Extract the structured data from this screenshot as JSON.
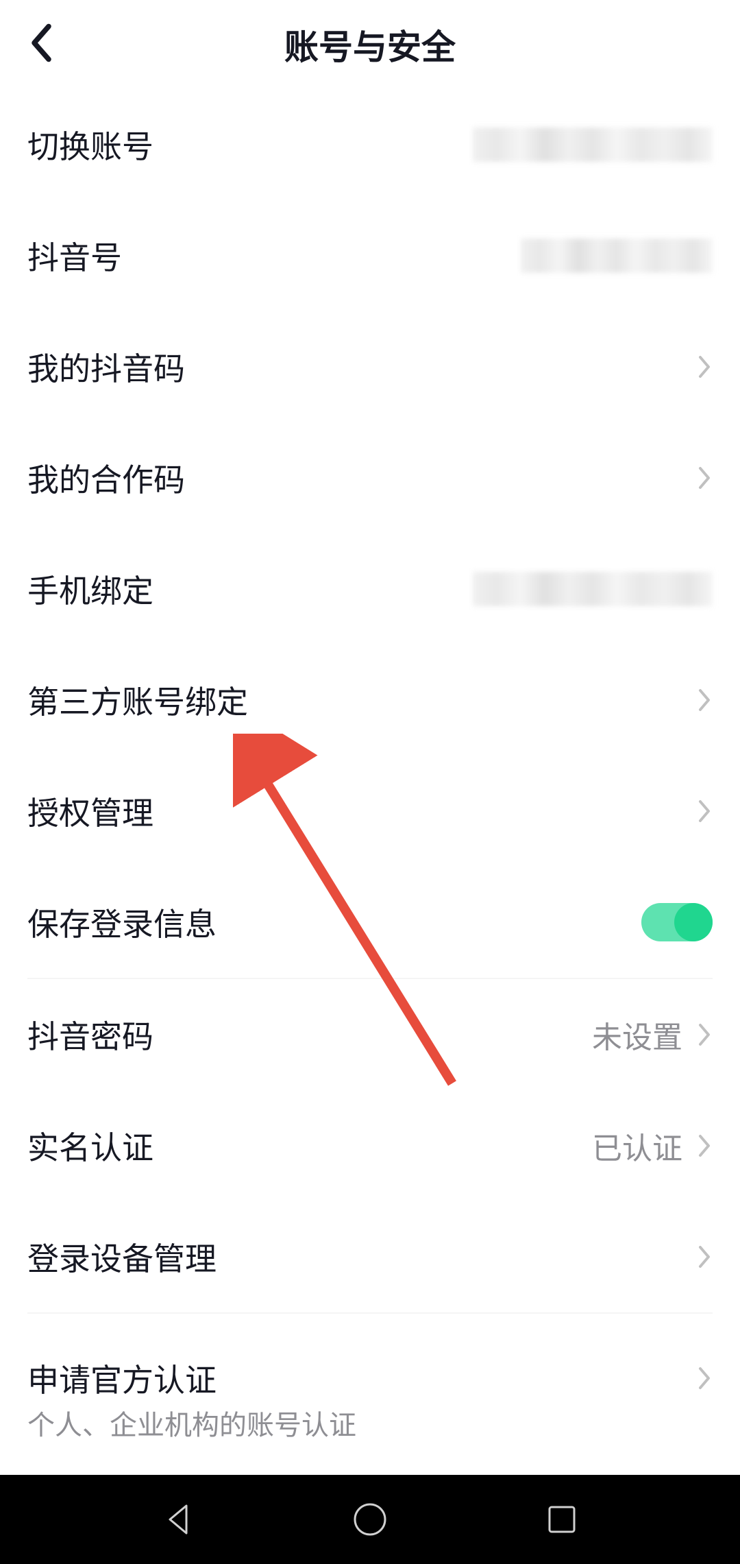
{
  "header": {
    "title": "账号与安全"
  },
  "items": [
    {
      "label": "切换账号",
      "type": "blurred",
      "hasChevron": false
    },
    {
      "label": "抖音号",
      "type": "blurred-small",
      "hasChevron": false
    },
    {
      "label": "我的抖音码",
      "type": "chevron",
      "hasChevron": true
    },
    {
      "label": "我的合作码",
      "type": "chevron",
      "hasChevron": true
    },
    {
      "label": "手机绑定",
      "type": "blurred",
      "hasChevron": false
    },
    {
      "label": "第三方账号绑定",
      "type": "chevron",
      "hasChevron": true
    },
    {
      "label": "授权管理",
      "type": "chevron",
      "hasChevron": true
    },
    {
      "label": "保存登录信息",
      "type": "toggle",
      "hasChevron": false
    }
  ],
  "items2": [
    {
      "label": "抖音密码",
      "value": "未设置",
      "hasChevron": true
    },
    {
      "label": "实名认证",
      "value": "已认证",
      "hasChevron": true
    },
    {
      "label": "登录设备管理",
      "value": "",
      "hasChevron": true
    }
  ],
  "items3": [
    {
      "label": "申请官方认证",
      "subtitle": "个人、企业机构的账号认证",
      "hasChevron": true
    }
  ]
}
